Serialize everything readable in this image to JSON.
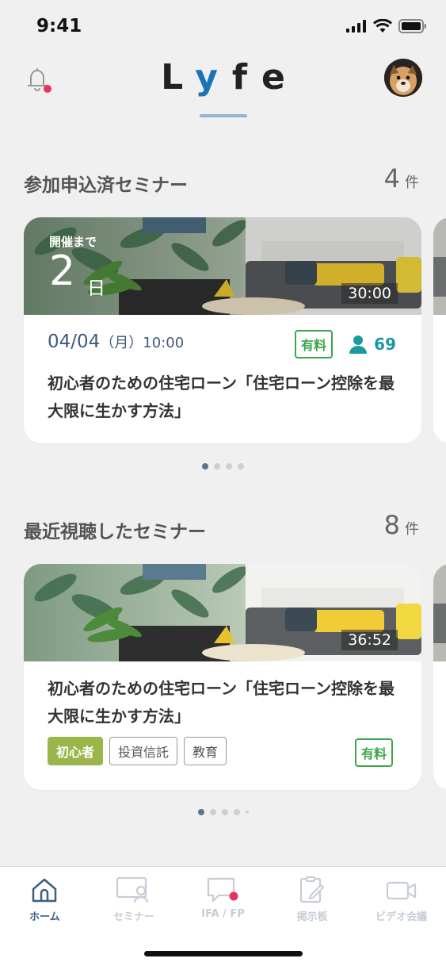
{
  "status_bar": {
    "time": "9:41"
  },
  "header": {
    "logo_l": "L",
    "logo_y": "y",
    "logo_f": "f",
    "logo_e": "e"
  },
  "registered": {
    "title": "参加申込済セミナー",
    "count": "4",
    "count_unit": "件",
    "card": {
      "countdown_label": "開催まで",
      "countdown_value": "2",
      "countdown_unit": "日",
      "duration": "30:00",
      "date": "04/04",
      "weekday": "（月）",
      "time": "10:00",
      "paid_label": "有料",
      "participants": "69",
      "title": "初心者のための住宅ローン「住宅ローン控除を最大限に生かす方法」"
    },
    "pagination": {
      "total": 4,
      "active": 0
    }
  },
  "recent": {
    "title": "最近視聴したセミナー",
    "count": "8",
    "count_unit": "件",
    "card": {
      "duration": "36:52",
      "title": "初心者のための住宅ローン「住宅ローン控除を最大限に生かす方法」",
      "tags": [
        "初心者",
        "投資信託",
        "教育"
      ],
      "paid_label": "有料"
    }
  },
  "tabbar": {
    "items": [
      {
        "label": "ホーム",
        "icon": "home-icon"
      },
      {
        "label": "セミナー",
        "icon": "seminar-icon"
      },
      {
        "label": "IFA / FP",
        "icon": "chat-icon"
      },
      {
        "label": "掲示板",
        "icon": "board-icon"
      },
      {
        "label": "ビデオ会議",
        "icon": "video-icon"
      }
    ],
    "active": 0
  },
  "colors": {
    "accent": "#1a73b5",
    "paid_green": "#3aa64a",
    "tag_primary": "#9bb54a",
    "participants_teal": "#1a9aa0",
    "notification_red": "#e8335a"
  }
}
